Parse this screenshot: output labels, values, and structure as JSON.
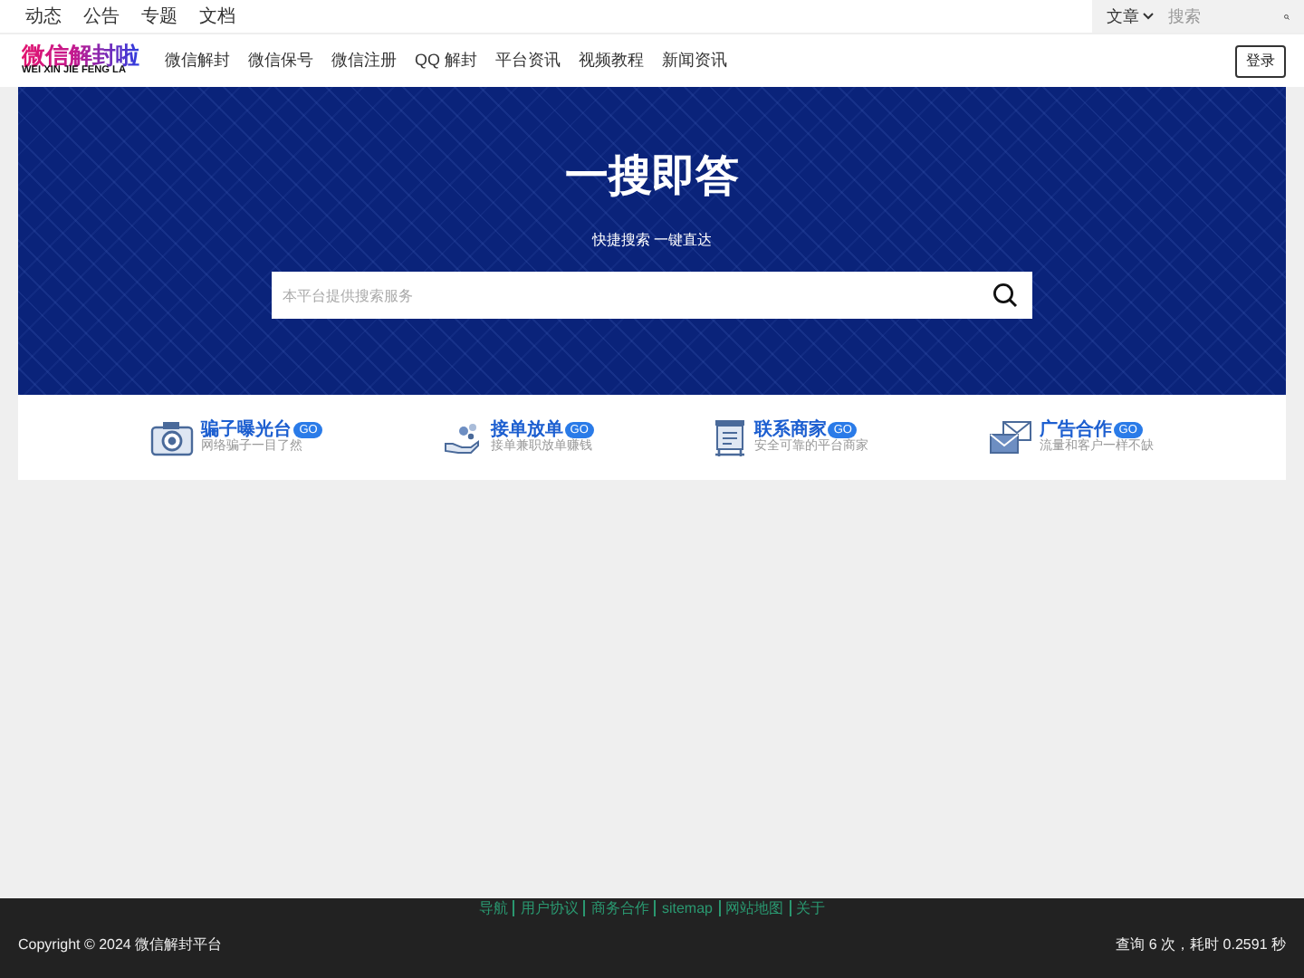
{
  "top_links": [
    "动态",
    "公告",
    "专题",
    "文档"
  ],
  "top_search": {
    "scope": "文章",
    "placeholder": "搜索"
  },
  "logo": {
    "title": "微信解封啦",
    "subtitle": "WEI XIN JIE FENG LA"
  },
  "nav": [
    "微信解封",
    "微信保号",
    "微信注册",
    "QQ 解封",
    "平台资讯",
    "视频教程",
    "新闻资讯"
  ],
  "login": "登录",
  "hero": {
    "title": "一搜即答",
    "subtitle": "快捷搜索 一键直达",
    "placeholder": "本平台提供搜索服务"
  },
  "features": [
    {
      "kind": "camera",
      "title": "骗子曝光台",
      "badge": "GO",
      "subtitle": "网络骗子一目了然"
    },
    {
      "kind": "hand",
      "title": "接单放单",
      "badge": "GO",
      "subtitle": "接单兼职放单赚钱"
    },
    {
      "kind": "board",
      "title": "联系商家",
      "badge": "GO",
      "subtitle": "安全可靠的平台商家"
    },
    {
      "kind": "mail",
      "title": "广告合作",
      "badge": "GO",
      "subtitle": "流量和客户一样不缺"
    }
  ],
  "footer": {
    "links": [
      "导航",
      "用户协议",
      "商务合作",
      "sitemap",
      "网站地图",
      "关于"
    ],
    "copyright": "Copyright © 2024 微信解封平台",
    "stats": "查询 6 次，耗时 0.2591 秒"
  }
}
